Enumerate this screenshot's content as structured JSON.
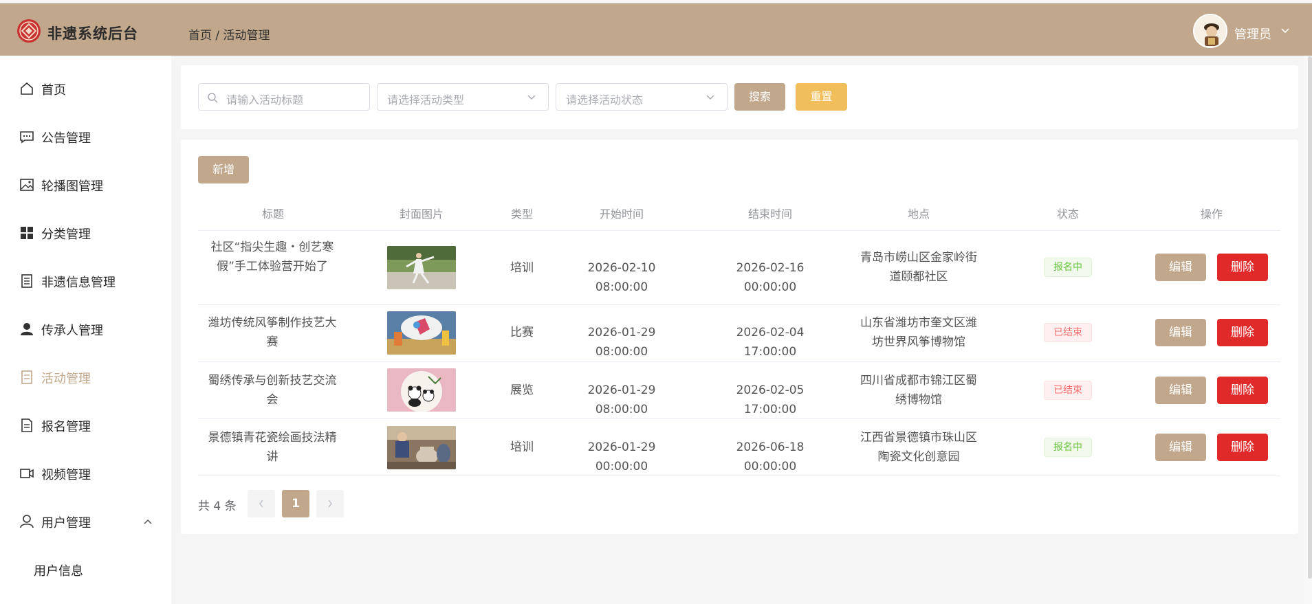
{
  "app": {
    "title": "非遗系统后台"
  },
  "breadcrumb": "首页 / 活动管理",
  "user": {
    "name": "管理员"
  },
  "colors": {
    "brand": "#c1a78b",
    "warning": "#f0be5a",
    "danger": "#e02a2a",
    "success": "#67c23a"
  },
  "sidebar": {
    "items": [
      {
        "label": "首页",
        "icon": "home-icon"
      },
      {
        "label": "公告管理",
        "icon": "message-icon"
      },
      {
        "label": "轮播图管理",
        "icon": "image-icon"
      },
      {
        "label": "分类管理",
        "icon": "grid-icon"
      },
      {
        "label": "非遗信息管理",
        "icon": "document-list-icon"
      },
      {
        "label": "传承人管理",
        "icon": "person-icon"
      },
      {
        "label": "活动管理",
        "icon": "tickets-icon",
        "active": true
      },
      {
        "label": "报名管理",
        "icon": "document-icon"
      },
      {
        "label": "视频管理",
        "icon": "video-camera-icon"
      },
      {
        "label": "用户管理",
        "icon": "user-icon",
        "expanded": true
      }
    ],
    "sub_items": [
      {
        "label": "用户信息"
      }
    ]
  },
  "search": {
    "title_placeholder": "请输入活动标题",
    "type_placeholder": "请选择活动类型",
    "status_placeholder": "请选择活动状态",
    "search_label": "搜索",
    "reset_label": "重置"
  },
  "toolbar": {
    "add_label": "新增"
  },
  "table": {
    "columns": [
      "标题",
      "封面图片",
      "类型",
      "开始时间",
      "结束时间",
      "地点",
      "状态",
      "操作"
    ],
    "rows": [
      {
        "title": "社区“指尖生趣・创艺寒假”手工体验营开始了",
        "type": "培训",
        "start": "2026-02-10 08:00:00",
        "end": "2026-02-16 00:00:00",
        "location": "青岛市崂山区金家岭街道颐都社区",
        "status": "报名中",
        "status_color": "green",
        "cover": "taichi-photo"
      },
      {
        "title": "潍坊传统风筝制作技艺大赛",
        "type": "比赛",
        "start": "2026-01-29 08:00:00",
        "end": "2026-02-04 17:00:00",
        "location": "山东省潍坊市奎文区潍坊世界风筝博物馆",
        "status": "已结束",
        "status_color": "red",
        "cover": "kite-photo"
      },
      {
        "title": "蜀绣传承与创新技艺交流会",
        "type": "展览",
        "start": "2026-01-29 08:00:00",
        "end": "2026-02-05 17:00:00",
        "location": "四川省成都市锦江区蜀绣博物馆",
        "status": "已结束",
        "status_color": "red",
        "cover": "panda-embroidery-photo"
      },
      {
        "title": "景德镇青花瓷绘画技法精讲",
        "type": "培训",
        "start": "2026-01-29 00:00:00",
        "end": "2026-06-18 00:00:00",
        "location": "江西省景德镇市珠山区陶瓷文化创意园",
        "status": "报名中",
        "status_color": "green",
        "cover": "pottery-photo"
      }
    ],
    "edit_label": "编辑",
    "delete_label": "删除"
  },
  "pagination": {
    "total_text": "共 4 条",
    "current_page": "1",
    "prev_icon": "chevron-left-icon",
    "next_icon": "chevron-right-icon"
  }
}
